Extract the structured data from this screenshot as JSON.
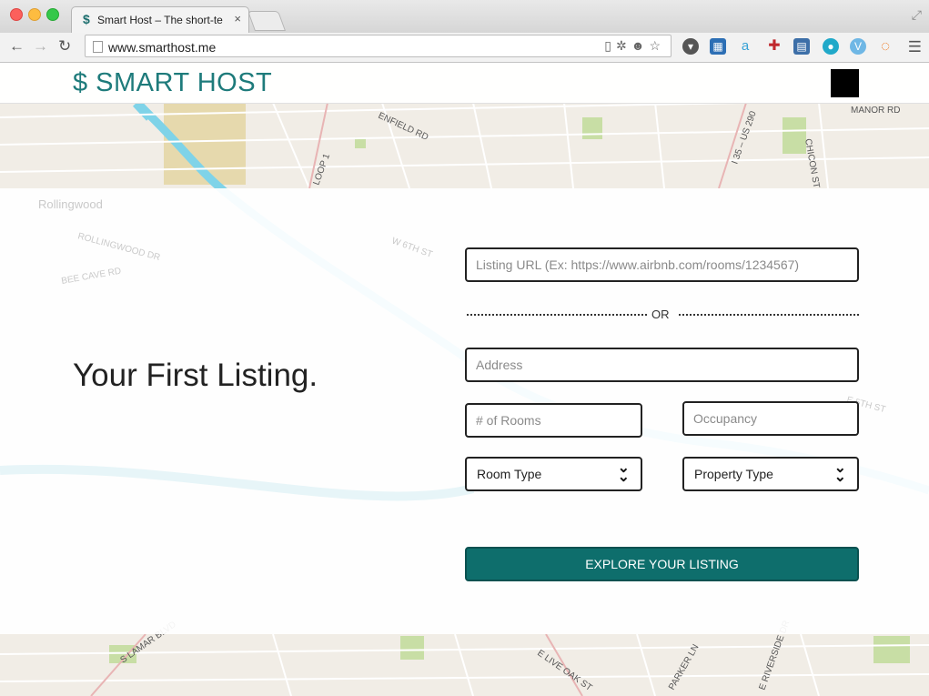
{
  "browser": {
    "tab_title": "Smart Host – The short-te",
    "tab_close": "×",
    "url": "www.smarthost.me",
    "favicon": "$"
  },
  "header": {
    "logo": "$ SMART HOST"
  },
  "main": {
    "headline": "Your First Listing.",
    "listing_url_placeholder": "Listing URL (Ex: https://www.airbnb.com/rooms/1234567)",
    "or_label": "OR",
    "address_placeholder": "Address",
    "rooms_placeholder": "# of Rooms",
    "occupancy_placeholder": "Occupancy",
    "room_type_label": "Room Type",
    "property_type_label": "Property Type",
    "cta_label": "EXPLORE YOUR LISTING"
  },
  "map_labels": [
    "MANOR RD",
    "ENFIELD RD",
    "LOOP 1",
    "I 35 – US 290",
    "CHICON ST",
    "Rollingwood",
    "ROLLINGWOOD DR",
    "BEE CAVE RD",
    "W 6TH ST",
    "E 5TH ST",
    "S LAMAR BLVD",
    "E LIVE OAK ST",
    "PARKER LN",
    "E RIVERSIDE DR"
  ],
  "colors": {
    "brand": "#1e7b7b",
    "cta": "#0e6e6c",
    "water": "#7fd3e8"
  }
}
